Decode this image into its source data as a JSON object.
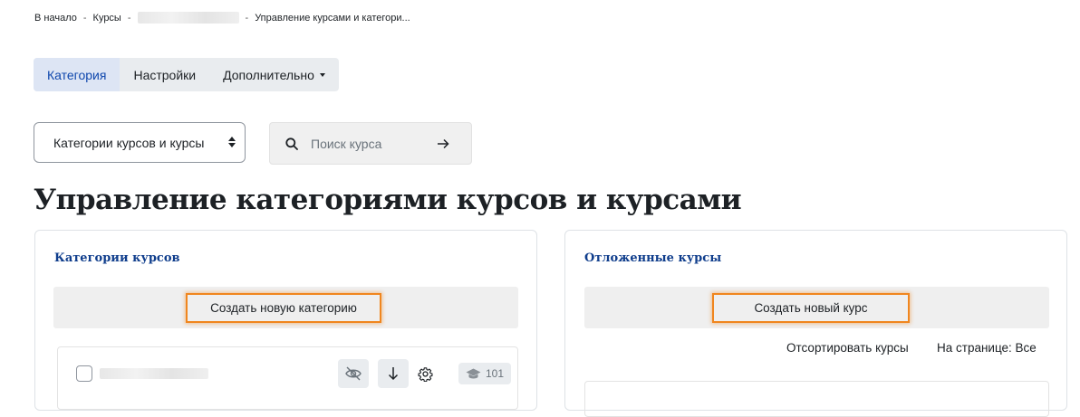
{
  "breadcrumb": {
    "home": "В начало",
    "courses": "Курсы",
    "sep": "-",
    "current": "Управление курсами и категори..."
  },
  "tabs": [
    {
      "label": "Категория"
    },
    {
      "label": "Настройки"
    },
    {
      "label": "Дополнительно"
    }
  ],
  "view_select": {
    "value": "Категории курсов и курсы"
  },
  "search": {
    "placeholder": "Поиск курса"
  },
  "page_title": "Управление категориями курсов и курсами",
  "categories_panel": {
    "title": "Категории курсов",
    "create_button": "Создать новую категорию",
    "rows": [
      {
        "course_count": "101"
      }
    ]
  },
  "courses_panel": {
    "title": "Отложенные курсы",
    "create_button": "Создать новый курс",
    "sort_link": "Отсортировать курсы",
    "per_page": "На странице: Все"
  },
  "colors": {
    "accent": "#0f47ad",
    "highlight": "#f0861e"
  },
  "icons": [
    "search-icon",
    "arrow-right-icon",
    "hide-icon",
    "arrow-down-icon",
    "gear-icon",
    "graduation-cap-icon"
  ]
}
